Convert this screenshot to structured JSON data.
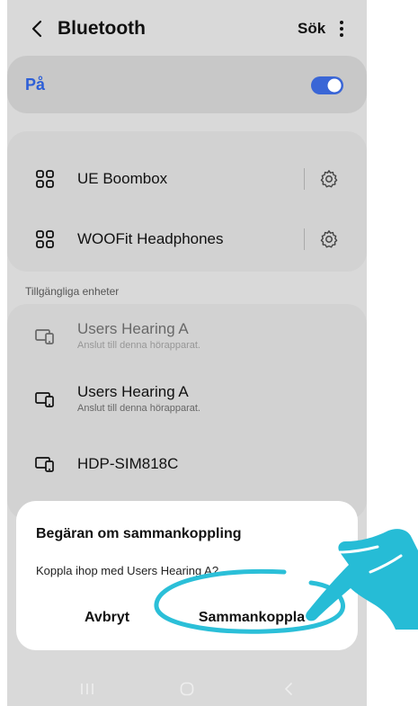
{
  "header": {
    "title": "Bluetooth",
    "search_label": "Sök",
    "back_icon": "chevron-left-icon",
    "more_icon": "more-vertical-icon"
  },
  "toggle": {
    "label": "På",
    "state": "on",
    "accent": "#2d5fd7"
  },
  "paired_devices": [
    {
      "name": "UE Boombox",
      "icon": "device-grid-icon",
      "action_icon": "gear-icon"
    },
    {
      "name": "WOOFit Headphones",
      "icon": "device-grid-icon",
      "action_icon": "gear-icon"
    }
  ],
  "available": {
    "header": "Tillgängliga enheter",
    "devices": [
      {
        "name": "Users Hearing A",
        "subtitle": "Anslut till denna hörapparat.",
        "icon": "hearing-device-icon",
        "dimmed": true
      },
      {
        "name": "Users Hearing A",
        "subtitle": "Anslut till denna hörapparat.",
        "icon": "hearing-device-icon",
        "dimmed": false
      },
      {
        "name": "HDP-SIM818C",
        "subtitle": "",
        "icon": "hearing-device-icon",
        "dimmed": false
      }
    ]
  },
  "dialog": {
    "title": "Begäran om sammankoppling",
    "message": "Koppla ihop med Users Hearing A?",
    "cancel_label": "Avbryt",
    "confirm_label": "Sammankoppla",
    "highlight_color": "#2bbfd8"
  },
  "navbar": {
    "recents_icon": "recents-icon",
    "home_icon": "home-icon",
    "back_icon": "nav-back-icon"
  }
}
